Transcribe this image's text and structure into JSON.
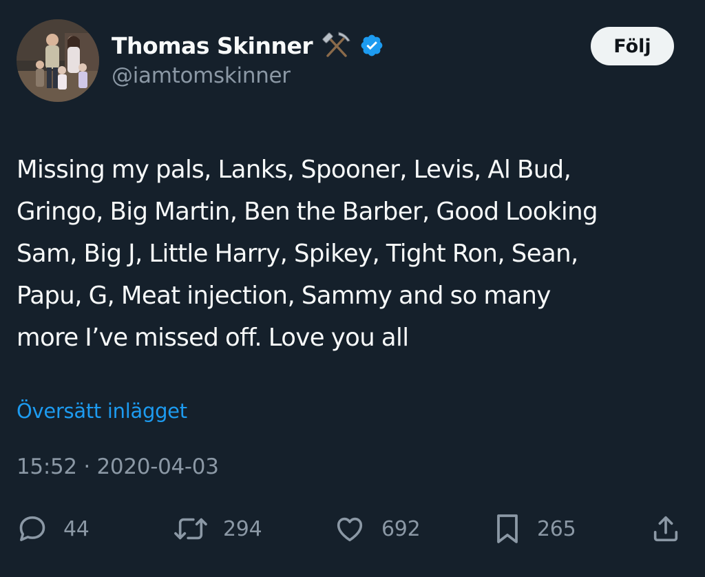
{
  "author": {
    "display_name": "Thomas Skinner",
    "handle": "@iamtomskinner",
    "name_emoji_icon": "hammer-and-pick-icon",
    "verified_icon": "verified-badge-icon",
    "avatar": "family-photo-avatar"
  },
  "follow_button": {
    "label": "Följ"
  },
  "tweet": {
    "text_lines": [
      "Missing my pals, Lanks, Spooner, Levis, Al Bud,",
      "Gringo, Big Martin, Ben the Barber, Good Looking",
      "Sam, Big J, Little Harry, Spikey, Tight Ron, Sean,",
      "Papu, G, Meat injection, Sammy and so many",
      "more I’ve missed off. Love you all"
    ],
    "translate_label": "Översätt inlägget",
    "timestamp": "15:52 · 2020-04-03"
  },
  "actions": {
    "reply": {
      "icon": "reply-icon",
      "count": "44"
    },
    "retweet": {
      "icon": "retweet-icon",
      "count": "294"
    },
    "like": {
      "icon": "heart-icon",
      "count": "692"
    },
    "bookmark": {
      "icon": "bookmark-icon",
      "count": "265"
    },
    "share": {
      "icon": "share-icon"
    }
  },
  "colors": {
    "background": "#15202b",
    "text_primary": "#f7f9f9",
    "text_secondary": "#8b98a5",
    "link": "#1d9bf0",
    "verified": "#1d9bf0",
    "follow_button_bg": "#eff3f4"
  }
}
